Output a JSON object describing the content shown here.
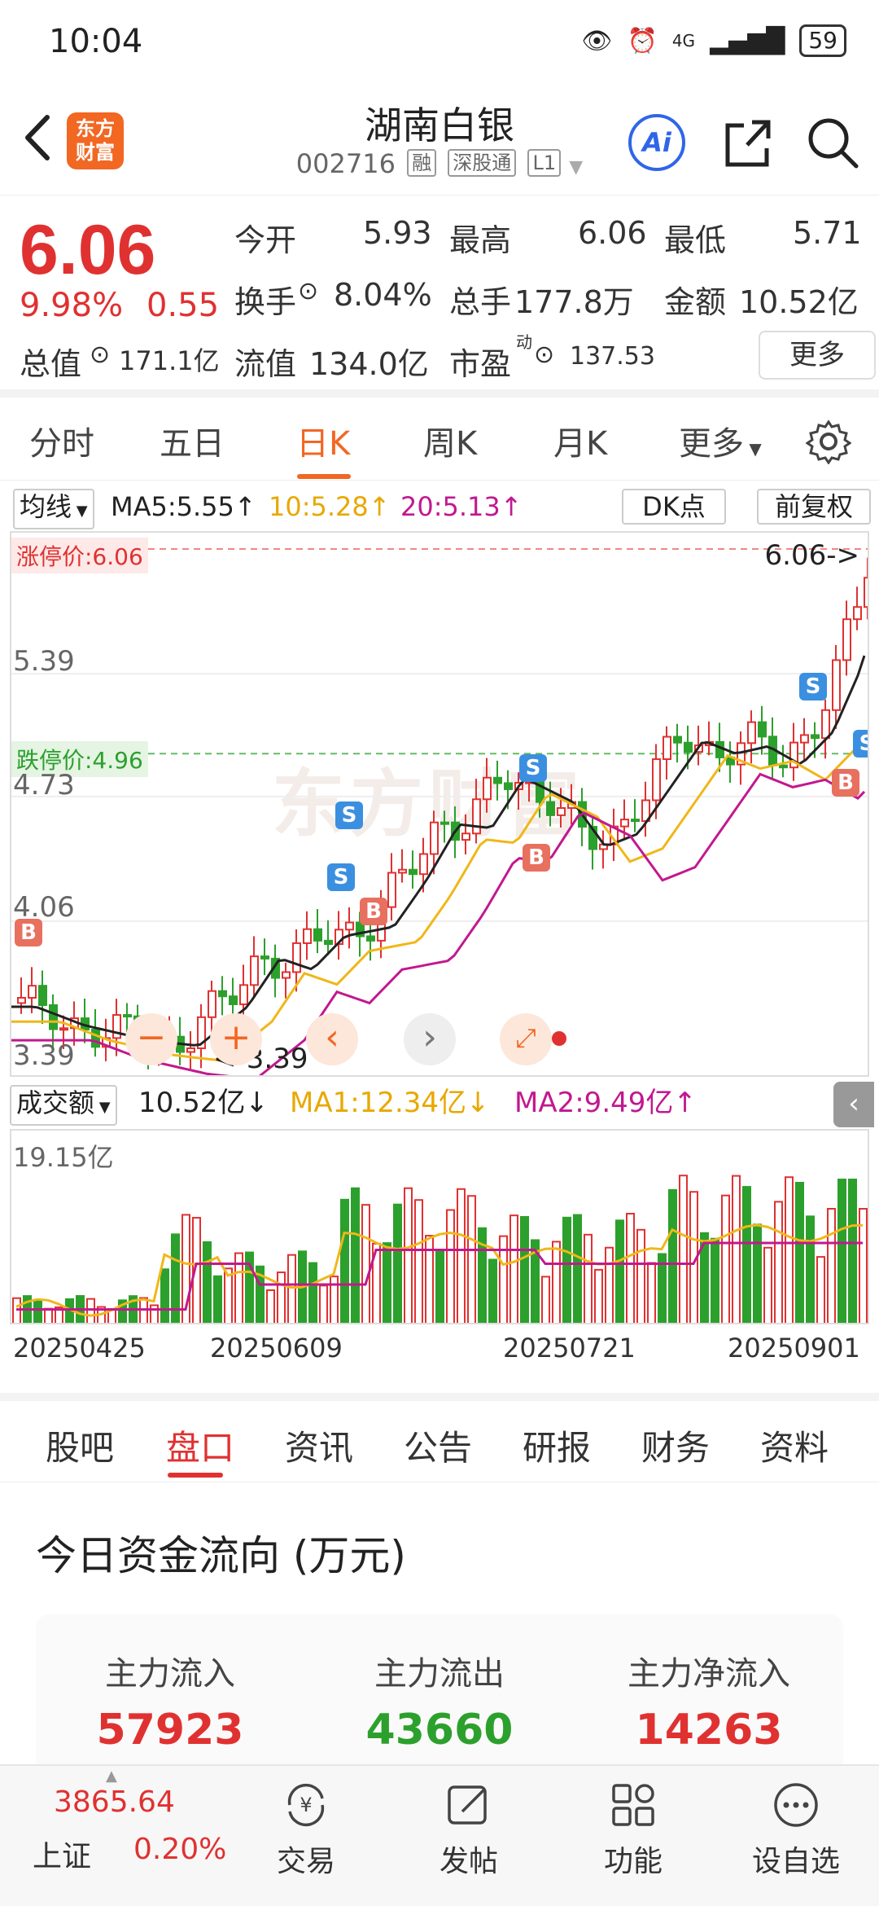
{
  "status_bar": {
    "time": "10:04",
    "network": "4G",
    "battery": "59"
  },
  "header": {
    "brand": "东方\n财富",
    "stock_name": "湖南白银",
    "stock_code": "002716",
    "tags": [
      "融",
      "深股通",
      "L1"
    ],
    "ai_label": "Ai"
  },
  "quote": {
    "price": "6.06",
    "change_pct": "9.98%",
    "change": "0.55",
    "open_label": "今开",
    "open": "5.93",
    "high_label": "最高",
    "high": "6.06",
    "low_label": "最低",
    "low": "5.71",
    "turnover_label": "换手",
    "turnover": "8.04%",
    "volume_label": "总手",
    "volume": "177.8万",
    "amount_label": "金额",
    "amount": "10.52亿",
    "mcap_label": "总值",
    "mcap": "171.1亿",
    "float_label": "流值",
    "float_cap": "134.0亿",
    "pe_label": "市盈",
    "pe_sup": "动",
    "pe": "137.53",
    "more_label": "更多"
  },
  "period_tabs": [
    "分时",
    "五日",
    "日K",
    "周K",
    "月K",
    "更多"
  ],
  "ma_row": {
    "selector": "均线",
    "ma5": "MA5:5.55↑",
    "ma10": "10:5.28↑",
    "ma20": "20:5.13↑",
    "dk": "DK点",
    "adjust": "前复权"
  },
  "kline": {
    "limit_up": "涨停价:6.06",
    "limit_down": "跌停价:4.96",
    "y_labels": [
      "6.06",
      "5.39",
      "4.73",
      "4.06",
      "3.39"
    ],
    "max_marker": "6.06->",
    "min_marker": "<-3.39",
    "watermark": "东方财富",
    "ctrl_zoom_out": "−",
    "ctrl_zoom_in": "+",
    "ctrl_prev": "‹",
    "ctrl_next": "›"
  },
  "volume": {
    "selector": "成交额",
    "current": "10.52亿↓",
    "ma1": "MA1:12.34亿↓",
    "ma2": "MA2:9.49亿↑",
    "max": "19.15亿"
  },
  "dates": [
    "20250425",
    "20250609",
    "20250721",
    "20250901"
  ],
  "info_tabs": [
    "股吧",
    "盘口",
    "资讯",
    "公告",
    "研报",
    "财务",
    "资料"
  ],
  "funds": {
    "title": "今日资金流向 (万元)",
    "inflow_label": "主力流入",
    "inflow": "57923",
    "outflow_label": "主力流出",
    "outflow": "43660",
    "net_label": "主力净流入",
    "net": "14263"
  },
  "bottom_bar": {
    "index_value": "3865.64",
    "index_name": "上证",
    "index_pct": "0.20%",
    "nav": [
      "交易",
      "发帖",
      "功能",
      "设自选"
    ]
  },
  "colors": {
    "up": "#e03131",
    "down": "#2ca02c",
    "accent": "#f26722",
    "ma5": "#222222",
    "ma10": "#f0b71a",
    "ma20": "#c2188f"
  }
}
